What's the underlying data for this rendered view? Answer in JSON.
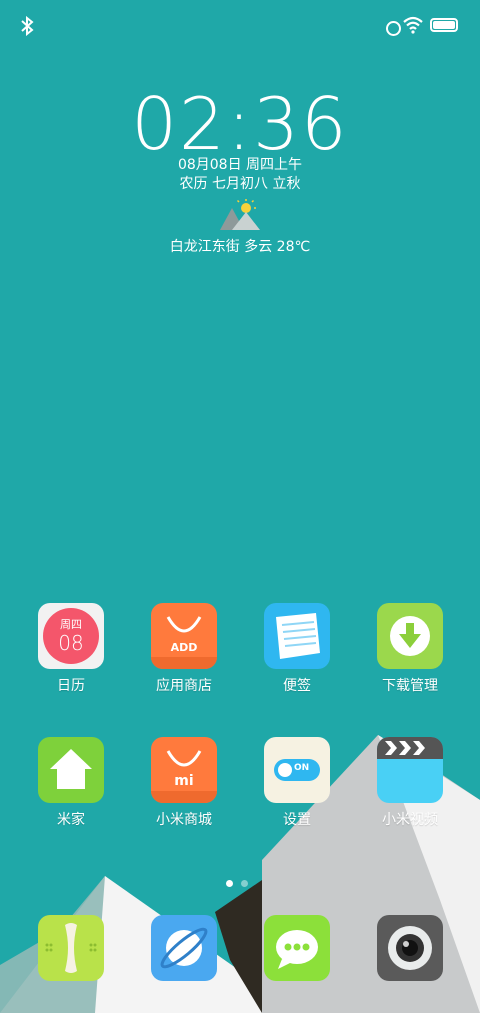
{
  "status": {
    "bluetooth_icon": "bluetooth-icon",
    "wifi_icon": "wifi-icon",
    "battery_icon": "battery-icon"
  },
  "lockclock": {
    "time": "02:36",
    "date": "08月08日 周四上午",
    "lunar": "农历 七月初八 立秋",
    "weather": "白龙江东街 多云 28℃"
  },
  "apps": [
    {
      "label": "日历",
      "color": "#f2f2f2",
      "day_name": "周四",
      "day_num": "08"
    },
    {
      "label": "应用商店",
      "color": "#ff7a3d",
      "badge": "ADD"
    },
    {
      "label": "便签",
      "color": "#2fb7f0"
    },
    {
      "label": "下载管理",
      "color": "#9bd84c"
    },
    {
      "label": "米家",
      "color": "#7ed13b"
    },
    {
      "label": "小米商城",
      "color": "#ff7a3d",
      "badge": "mi"
    },
    {
      "label": "设置",
      "color": "#f6f2e2",
      "toggle": "ON"
    },
    {
      "label": "小米视频",
      "color": "#49d0f5"
    }
  ],
  "dock": [
    {
      "name": "phone",
      "color": "#b9e24a"
    },
    {
      "name": "browser",
      "color": "#4aa8f0"
    },
    {
      "name": "messages",
      "color": "#8ce03a"
    },
    {
      "name": "camera",
      "color": "#555555"
    }
  ],
  "page_indicator": {
    "pages": 2,
    "current": 1
  }
}
